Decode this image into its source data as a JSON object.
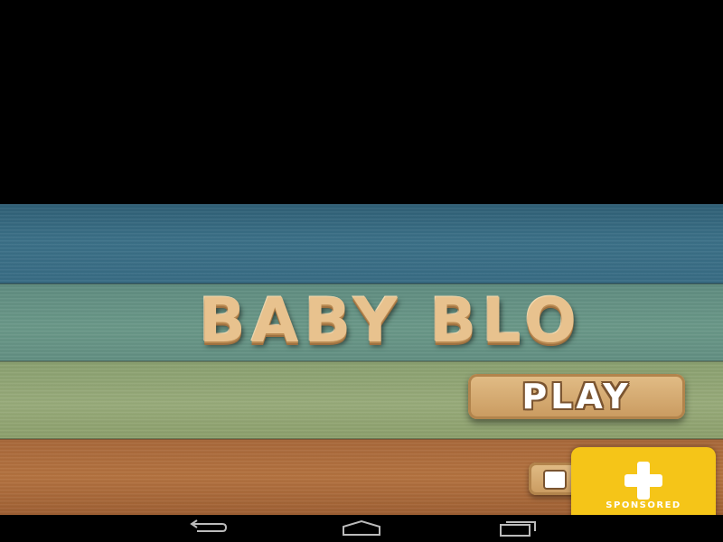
{
  "game": {
    "title": "BABY BLO",
    "play_label": "PLAY"
  },
  "sponsored": {
    "label": "SPONSORED",
    "icon": "plus-icon",
    "color": "#f5c518"
  },
  "navbar": {
    "back_icon": "back-arrow-icon",
    "home_icon": "home-icon",
    "recents_icon": "recent-apps-icon"
  },
  "colors": {
    "plank_blue": "#3b7087",
    "plank_teal": "#6a9888",
    "plank_green": "#98ab7a",
    "plank_orange": "#b3723f",
    "wood_text": "#e8c28e"
  }
}
